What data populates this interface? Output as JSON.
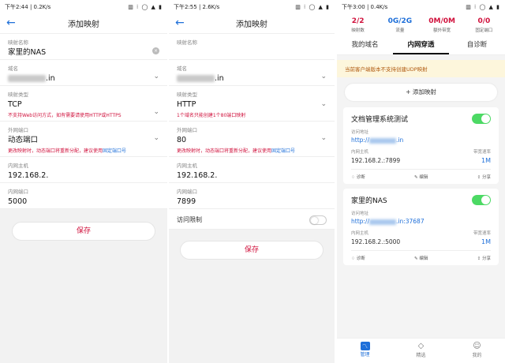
{
  "phone1": {
    "status_time": "下午2:44 | 0.2K/s",
    "status_right": "▥ ⁝ ◯ ▲ ▮",
    "title": "添加映射",
    "name_label": "映射名称",
    "name_value": "家里的NAS",
    "domain_label": "域名",
    "domain_suffix": ".in",
    "type_label": "映射类型",
    "type_value": "TCP",
    "type_hint": "不支持Web访问方式，如有需要请使用HTTP或HTTPS",
    "ext_port_label": "外网端口",
    "ext_port_value": "动态端口",
    "ext_hint": "更改映射时，动态端口将重新分配，建议使用",
    "ext_hint_link": "固定端口号",
    "host_label": "内网主机",
    "host_value": "192.168.2.",
    "port_label": "内网端口",
    "port_value": "5000",
    "save_label": "保存"
  },
  "phone2": {
    "status_time": "下午2:55 | 2.6K/s",
    "status_right": "▥ ⁝ ◯ ▲ ▮",
    "title": "添加映射",
    "name_label": "映射名称",
    "domain_label": "域名",
    "domain_suffix": ".in",
    "type_label": "映射类型",
    "type_value": "HTTP",
    "type_hint": "1个域名只能创建1个80端口映射",
    "ext_port_label": "外网端口",
    "ext_port_value": "80",
    "ext_hint": "更改映射时，动态端口将重新分配，建议使用",
    "ext_hint_link": "固定端口号",
    "host_label": "内网主机",
    "host_value": "192.168.2.",
    "port_label": "内网端口",
    "port_value": "7899",
    "access_label": "访问限制",
    "save_label": "保存"
  },
  "phone3": {
    "status_time": "下午3:00 | 0.4K/s",
    "status_right": "▥ ⁝ ◯ ▲ ▮",
    "stats": [
      {
        "num": "2/2",
        "cap": "映射数"
      },
      {
        "num": "0G/2G",
        "cap": "流量"
      },
      {
        "num": "0M/0M",
        "cap": "额外带宽"
      },
      {
        "num": "0/0",
        "cap": "固定端口"
      }
    ],
    "tabs": [
      "我的域名",
      "内网穿透",
      "自诊断"
    ],
    "notice": "当前客户端版本不支持创建UDP映射",
    "add_label": "+ 添加映射",
    "card1": {
      "name": "文档管理系统测试",
      "access_label": "访问地址",
      "url_prefix": "http://",
      "url_suffix": ".in",
      "host_label": "内网主机",
      "bw_label": "带宽速率",
      "host_value": "192.168.2.",
      "host_port": ":7899",
      "bw_value": "1M",
      "act_diag": "诊断",
      "act_edit": "编辑",
      "act_share": "分享"
    },
    "card2": {
      "name": "家里的NAS",
      "access_label": "访问地址",
      "url_prefix": "http://",
      "url_suffix": ".in:37687",
      "host_label": "内网主机",
      "bw_label": "带宽速率",
      "host_value": "192.168.2.",
      "host_port": ":5000",
      "bw_value": "1M",
      "act_diag": "诊断",
      "act_edit": "编辑",
      "act_share": "分享"
    },
    "bottom": [
      "管理",
      "精选",
      "我的"
    ]
  },
  "colors": {
    "accent": "#1e6fd9",
    "danger": "#d0113c",
    "switch_on": "#4cd964"
  }
}
